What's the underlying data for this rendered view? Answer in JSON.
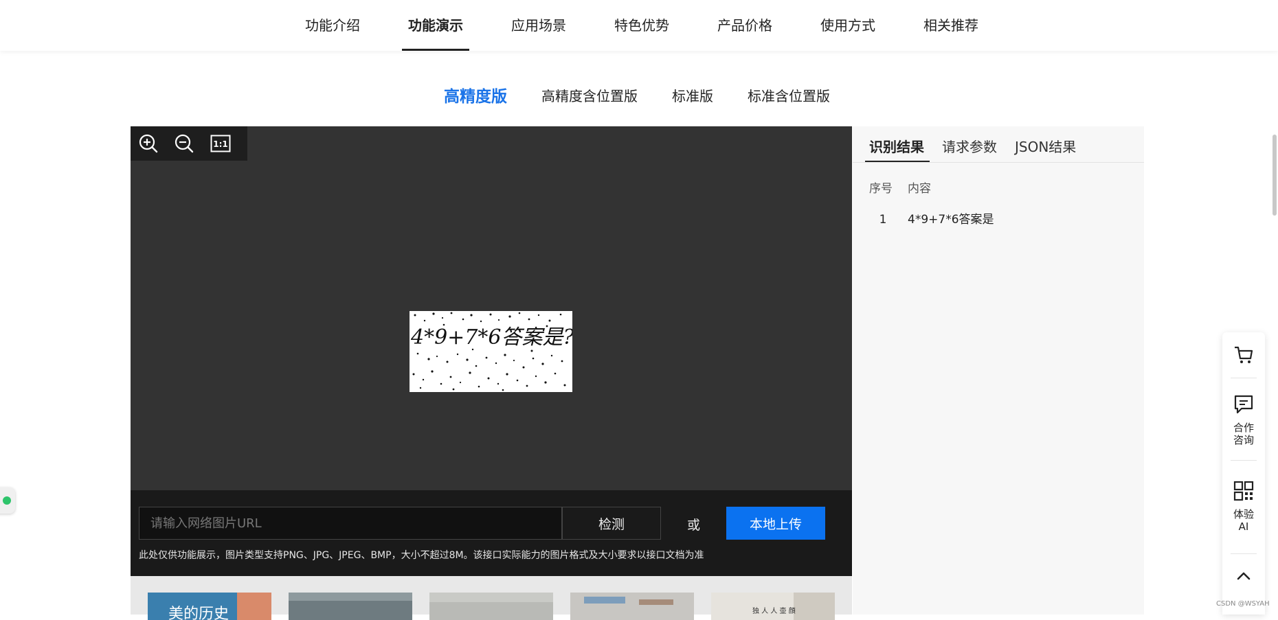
{
  "topnav": {
    "items": [
      {
        "label": "功能介绍"
      },
      {
        "label": "功能演示"
      },
      {
        "label": "应用场景"
      },
      {
        "label": "特色优势"
      },
      {
        "label": "产品价格"
      },
      {
        "label": "使用方式"
      },
      {
        "label": "相关推荐"
      }
    ],
    "active_index": 1
  },
  "subtabs": {
    "items": [
      {
        "label": "高精度版"
      },
      {
        "label": "高精度含位置版"
      },
      {
        "label": "标准版"
      },
      {
        "label": "标准含位置版"
      }
    ],
    "active_index": 0
  },
  "viewer": {
    "tools": [
      "zoom-in-icon",
      "zoom-out-icon",
      "actual-size-icon"
    ],
    "actual_size_label": "1:1",
    "preview_text": "4*9+7*6答案是?"
  },
  "input": {
    "url_placeholder": "请输入网络图片URL",
    "detect_label": "检测",
    "or_label": "或",
    "upload_label": "本地上传",
    "note": "此处仅供功能展示，图片类型支持PNG、JPG、JPEG、BMP，大小不超过8M。该接口实际能力的图片格式及大小要求以接口文档为准"
  },
  "result": {
    "tabs": [
      {
        "label": "识别结果"
      },
      {
        "label": "请求参数"
      },
      {
        "label": "JSON结果"
      }
    ],
    "active_index": 0,
    "columns": {
      "index": "序号",
      "content": "内容"
    },
    "rows": [
      {
        "index": "1",
        "content": "4*9+7*6答案是"
      }
    ]
  },
  "floatbar": {
    "cart_icon": "cart-icon",
    "consult_label_1": "合作",
    "consult_label_2": "咨询",
    "try_label_1": "体验",
    "try_label_2": "AI",
    "top_icon": "chevron-up-icon"
  },
  "watermark": "CSDN @WSYAH",
  "colors": {
    "accent": "#0b72f0",
    "viewer_bg": "#333333",
    "toolbar_bg": "#1e1e1e"
  }
}
